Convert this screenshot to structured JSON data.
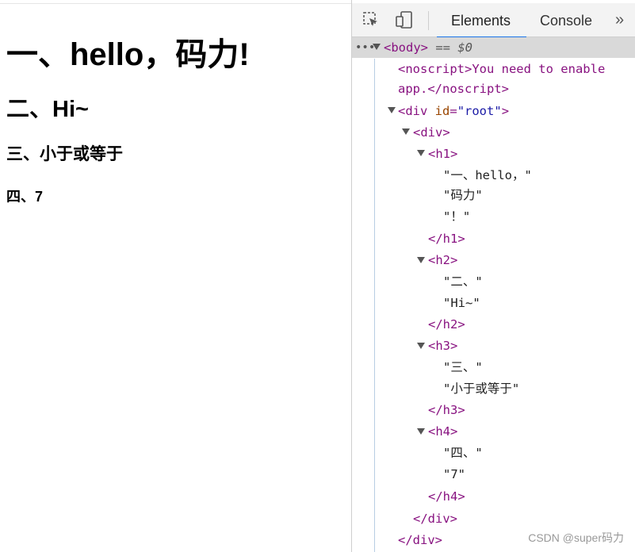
{
  "page": {
    "h1": "一、hello，码力!",
    "h2": "二、Hi~",
    "h3": "三、小于或等于",
    "h4": "四、7"
  },
  "devtools": {
    "tabs": [
      "Elements",
      "Console"
    ],
    "more": "»",
    "icons": [
      "inspect-element-icon",
      "device-toolbar-icon"
    ],
    "dom": {
      "selected_ellipsis": "•••",
      "body_open": "<body>",
      "body_eq": "== $0",
      "noscript_line1": "<noscript>You need to enable",
      "noscript_line2": "app.</noscript>",
      "root_tag": "<div",
      "root_attr": "id",
      "root_val": "\"root\"",
      "root_close": ">",
      "div_open": "<div>",
      "h1_open": "<h1>",
      "h1_t1": "\"一、hello，\"",
      "h1_t2": "\"码力\"",
      "h1_t3": "\"！\"",
      "h1_close": "</h1>",
      "h2_open": "<h2>",
      "h2_t1": "\"二、\"",
      "h2_t2": "\"Hi~\"",
      "h2_close": "</h2>",
      "h3_open": "<h3>",
      "h3_t1": "\"三、\"",
      "h3_t2": "\"小于或等于\"",
      "h3_close": "</h3>",
      "h4_open": "<h4>",
      "h4_t1": "\"四、\"",
      "h4_t2": "\"7\"",
      "h4_close": "</h4>",
      "div_close": "</div>",
      "root_div_close": "</div>"
    }
  },
  "watermark": "CSDN @super码力"
}
